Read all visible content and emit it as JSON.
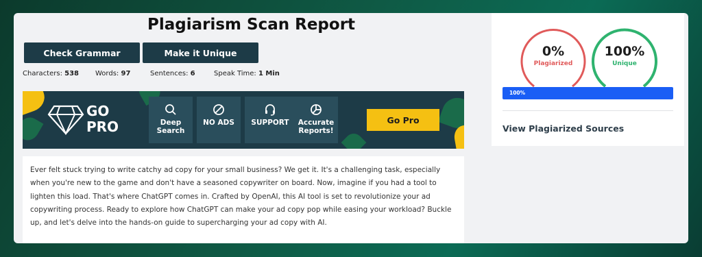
{
  "report": {
    "title": "Plagiarism Scan Report",
    "buttons": {
      "check_grammar": "Check Grammar",
      "make_unique": "Make it Unique"
    },
    "stats": {
      "characters_label": "Characters:",
      "characters_value": "538",
      "words_label": "Words:",
      "words_value": "97",
      "sentences_label": "Sentences:",
      "sentences_value": "6",
      "speak_time_label": "Speak Time:",
      "speak_time_value": "1 Min"
    }
  },
  "banner": {
    "brand_line1": "GO",
    "brand_line2": "PRO",
    "features": [
      {
        "icon": "search-icon",
        "label_line1": "Deep",
        "label_line2": "Search"
      },
      {
        "icon": "no-ads-icon",
        "label_line1": "NO ADS",
        "label_line2": ""
      },
      {
        "icon": "headset-icon",
        "label_line1": "SUPPORT",
        "label_line2": ""
      },
      {
        "icon": "pie-chart-icon",
        "label_line1": "Accurate",
        "label_line2": "Reports!"
      }
    ],
    "cta": "Go Pro",
    "colors": {
      "background": "#1d3b47",
      "accent": "#f5c012",
      "leaf_green": "#1a6b4a"
    }
  },
  "content": {
    "text": "Ever felt stuck trying to write catchy ad copy for your small business? We get it. It's a challenging task, especially when you're new to the game and don't have a seasoned copywriter on board. Now, imagine if you had a tool to lighten this load. That's where ChatGPT comes in. Crafted by OpenAI, this AI tool is set to revolutionize your ad copywriting process. Ready to explore how ChatGPT can make your ad copy pop while easing your workload? Buckle up, and let's delve into the hands-on guide to supercharging your ad copy with AI."
  },
  "results": {
    "plagiarized": {
      "value": "0%",
      "label": "Plagiarized",
      "color": "#e05a5a",
      "fraction": 0.0
    },
    "unique": {
      "value": "100%",
      "label": "Unique",
      "color": "#2fb36f",
      "fraction": 1.0
    },
    "progress": {
      "label": "100%",
      "fraction": 1.0,
      "color": "#1a5ef5"
    },
    "sources_link": "View Plagiarized Sources"
  }
}
